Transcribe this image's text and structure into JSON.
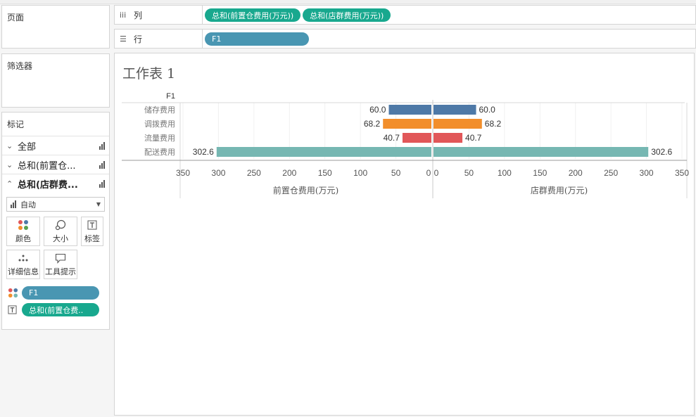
{
  "panels": {
    "pages": "页面",
    "filters": "筛选器",
    "marks": "标记"
  },
  "marks": {
    "rows": [
      {
        "label": "全部",
        "chevron": "⌄",
        "active": false
      },
      {
        "label": "总和(前置仓...",
        "chevron": "⌄",
        "active": false
      },
      {
        "label": "总和(店群费...",
        "chevron": "⌃",
        "active": true
      }
    ],
    "mark_type": "自动",
    "cards": {
      "color": "颜色",
      "size": "大小",
      "label": "标签",
      "detail": "详细信息",
      "tooltip": "工具提示"
    },
    "fields": [
      {
        "icon": "color-dots-icon",
        "name": "F1",
        "color": "#4996b2"
      },
      {
        "icon": "text-label-icon",
        "name": "总和(前置仓费..",
        "color": "#18a88e"
      }
    ]
  },
  "shelves": {
    "columns_label": "列",
    "rows_label": "行",
    "columns_pills": [
      "总和(前置仓费用(万元))",
      "总和(店群费用(万元))"
    ],
    "rows_pills": [
      "F1"
    ]
  },
  "sheet": {
    "title": "工作表 1"
  },
  "chart_data": {
    "type": "bar",
    "row_header": "F1",
    "categories": [
      "储存费用",
      "调拨费用",
      "流量费用",
      "配送费用"
    ],
    "category_colors": [
      "#4e79a7",
      "#f28e2b",
      "#e15759",
      "#76b7b2"
    ],
    "left": {
      "axis_title": "前置仓费用(万元)",
      "values": [
        60.0,
        68.2,
        40.7,
        302.6
      ],
      "labels": [
        "60.0",
        "68.2",
        "40.7",
        "302.6"
      ],
      "ticks": [
        "350",
        "300",
        "250",
        "200",
        "150",
        "100",
        "50",
        "0"
      ],
      "range": [
        0,
        350
      ],
      "reversed": true
    },
    "right": {
      "axis_title": "店群费用(万元)",
      "values": [
        60.0,
        68.2,
        40.7,
        302.6
      ],
      "labels": [
        "60.0",
        "68.2",
        "40.7",
        "302.6"
      ],
      "ticks": [
        "0",
        "50",
        "100",
        "150",
        "200",
        "250",
        "300",
        "350"
      ],
      "range": [
        0,
        350
      ],
      "reversed": false
    }
  }
}
